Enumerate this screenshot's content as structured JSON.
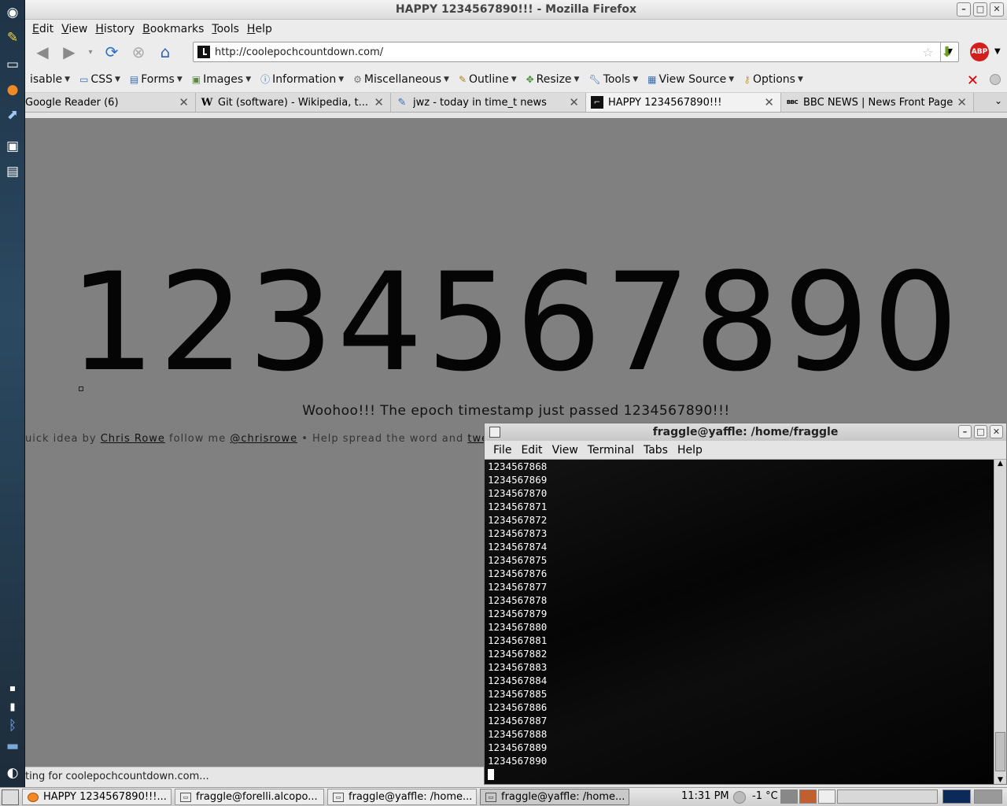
{
  "window": {
    "title": "HAPPY 1234567890!!! - Mozilla Firefox"
  },
  "menubar": {
    "items": [
      "Edit",
      "View",
      "History",
      "Bookmarks",
      "Tools",
      "Help"
    ]
  },
  "navbar": {
    "url": "http://coolepochcountdown.com/"
  },
  "webdev": {
    "items": [
      "isable",
      "CSS",
      "Forms",
      "Images",
      "Information",
      "Miscellaneous",
      "Outline",
      "Resize",
      "Tools",
      "View Source",
      "Options"
    ]
  },
  "tabs": [
    {
      "label": "Google Reader (6)",
      "icon": "google-reader-icon",
      "selected": false
    },
    {
      "label": "Git (software) - Wikipedia, t...",
      "icon": "wikipedia-icon",
      "selected": false
    },
    {
      "label": "jwz - today in time_t news",
      "icon": "pencil-icon",
      "selected": false
    },
    {
      "label": "HAPPY 1234567890!!!",
      "icon": "clock-site-icon",
      "selected": true
    },
    {
      "label": "BBC NEWS | News Front Page",
      "icon": "bbc-icon",
      "selected": false
    }
  ],
  "page": {
    "big_number": "1234567890",
    "message": "Woohoo!!! The epoch timestamp just passed 1234567890!!!",
    "credit_prefix": "uick idea by ",
    "credit_author": "Chris Rowe",
    "credit_follow": " follow me ",
    "credit_handle": "@chrisrowe",
    "credit_sep": "  •  Help spread the word and ",
    "credit_tweet": "twee"
  },
  "status": {
    "text": "ting for coolepochcountdown.com..."
  },
  "terminal": {
    "title": "fraggle@yaffle: /home/fraggle",
    "menu": [
      "File",
      "Edit",
      "View",
      "Terminal",
      "Tabs",
      "Help"
    ],
    "lines": [
      "1234567868",
      "1234567869",
      "1234567870",
      "1234567871",
      "1234567872",
      "1234567873",
      "1234567874",
      "1234567875",
      "1234567876",
      "1234567877",
      "1234567878",
      "1234567879",
      "1234567880",
      "1234567881",
      "1234567882",
      "1234567883",
      "1234567884",
      "1234567885",
      "1234567886",
      "1234567887",
      "1234567888",
      "1234567889",
      "1234567890"
    ]
  },
  "taskbar": {
    "items": [
      "HAPPY 1234567890!!!...",
      "fraggle@forelli.alcopo...",
      "fraggle@yaffle: /home...",
      "fraggle@yaffle: /home..."
    ],
    "clock": "11:31 PM",
    "temperature": "-1 °C"
  }
}
